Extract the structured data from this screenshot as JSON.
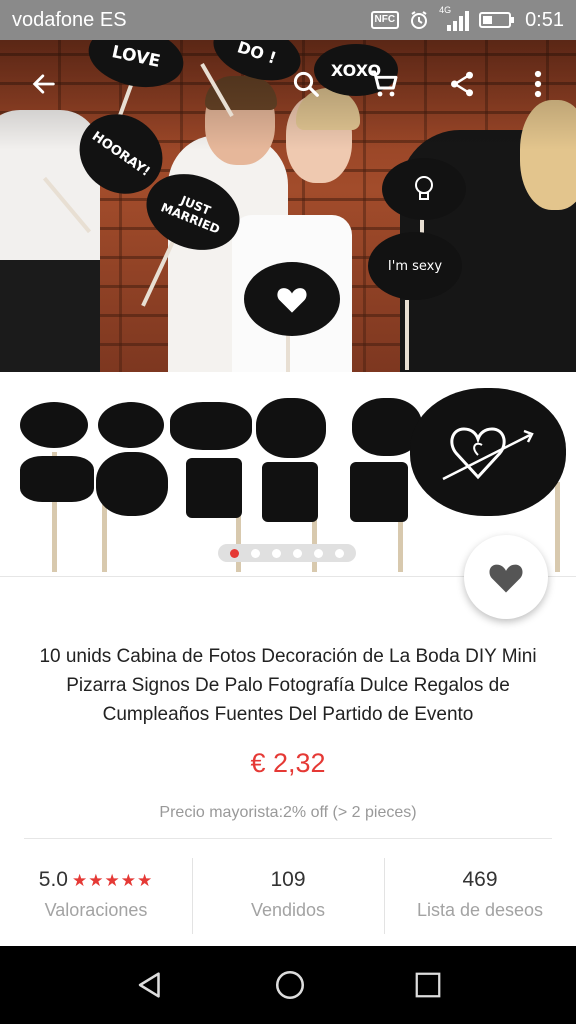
{
  "status_bar": {
    "carrier": "vodafone ES",
    "nfc": "NFC",
    "network": "4G",
    "time": "0:51"
  },
  "toolbar": {
    "back_icon": "arrow-left-icon",
    "search_icon": "search-icon",
    "cart_icon": "cart-icon",
    "share_icon": "share-icon",
    "more_icon": "more-vertical-icon"
  },
  "photo_props": {
    "love": "LOVE",
    "do": "DO !",
    "xoxo": "XOXO",
    "hooray": "HOORAY!",
    "just_married": "JUST MARRIED",
    "im_sexy": "I'm sexy"
  },
  "gallery": {
    "page_count": 6,
    "active_page": 1
  },
  "product": {
    "title": "10 unids Cabina de Fotos Decoración de La Boda DIY Mini Pizarra Signos De Palo Fotografía Dulce Regalos de Cumpleaños Fuentes Del Partido de Evento",
    "price": "€ 2,32",
    "wholesale": "Precio mayorista:2% off (> 2 pieces)"
  },
  "stats": {
    "rating_value": "5.0",
    "rating_stars": "★★★★★",
    "rating_label": "Valoraciones",
    "sold_value": "109",
    "sold_label": "Vendidos",
    "wishlist_value": "469",
    "wishlist_label": "Lista de deseos"
  },
  "colors": {
    "accent": "#e53935",
    "status_bar": "#8a8a8a"
  }
}
